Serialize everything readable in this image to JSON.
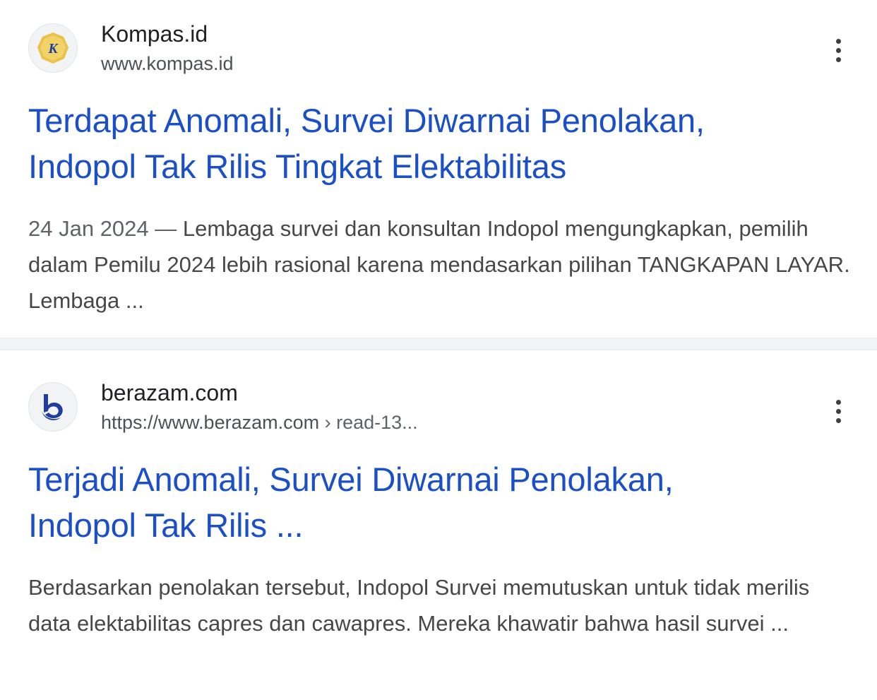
{
  "results": [
    {
      "site_name": "Kompas.id",
      "site_url": "www.kompas.id",
      "favicon_letter": "K",
      "title_line1": "Terdapat Anomali, Survei Diwarnai Penolakan,",
      "title_line2": "Indopol Tak Rilis Tingkat Elektabilitas",
      "date": "24 Jan 2024",
      "date_sep": " — ",
      "snippet": "Lembaga survei dan konsultan Indopol mengungkapkan, pemilih dalam Pemilu 2024 lebih rasional karena mendasarkan pilihan TANGKAPAN LAYAR. Lembaga ..."
    },
    {
      "site_name": "berazam.com",
      "site_url": "https://www.berazam.com",
      "site_crumb": " › read-13...",
      "title_line1": "Terjadi Anomali, Survei Diwarnai Penolakan,",
      "title_line2": "Indopol Tak Rilis ...",
      "snippet": "Berdasarkan penolakan tersebut, Indopol Survei memutuskan untuk tidak merilis data elektabilitas capres dan cawapres. Mereka khawatir bahwa hasil survei ..."
    }
  ],
  "colors": {
    "link": "#1a4fc9",
    "kompas_gold": "#e8c24a",
    "berazam_blue": "#1f3d9e"
  }
}
